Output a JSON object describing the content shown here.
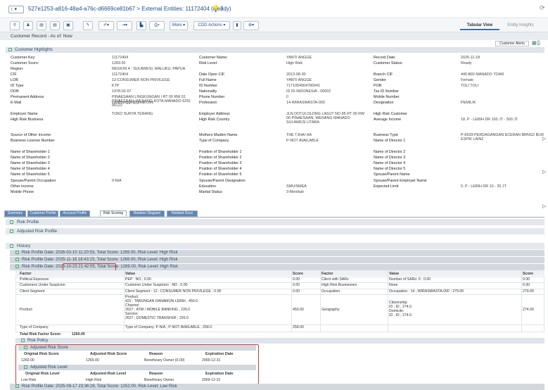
{
  "titlebar": {
    "nav": "↕ ▾",
    "title": "527e1253-a816-48a4-a76c-d6669ce81b67 > External Entities: 11172404 (Ready)",
    "bulb": "💡",
    "help": "?",
    "refresh": "⟳"
  },
  "toolbar": {
    "more_label": "More ▾",
    "cdd_label": "CDD Actions ▾",
    "tab_tabular": "Tabular View",
    "tab_insights": "Entity Insights"
  },
  "record_bar": "Customer Record - As of: Now",
  "alerts_button": "Customer Alerts",
  "highlights_title": "Customer Highlights",
  "fields": [
    {
      "label": "Customer Key:",
      "value": "11172404"
    },
    {
      "label": "Customer Name:",
      "value": "YANTI ANGGE"
    },
    {
      "label": "Record Date:",
      "value": "2025-11-18"
    },
    {
      "label": "Customer Score:",
      "value": "1269.00"
    },
    {
      "label": "Risk Level:",
      "value": "High Risk"
    },
    {
      "label": "Customer Status:",
      "value": "Ready"
    },
    {
      "label": "Region:",
      "value": "REGION 4 : SULAWESI, MALUKU, PAPUA"
    },
    {
      "label": "CIF",
      "value": "11172404"
    },
    {
      "label": "Date Open CIF",
      "value": "2013-08-30"
    },
    {
      "label": "Branch CIF",
      "value": "440-BDI MANADO TOAR"
    },
    {
      "label": "LOB",
      "value": "12-CONSUMER NON PRIVILEGE"
    },
    {
      "label": "Full Name",
      "value": "YANTI ANGGE"
    },
    {
      "label": "Gender",
      "value": "Female"
    },
    {
      "label": "ID Type",
      "value": "KTP"
    },
    {
      "label": "ID Number",
      "value": "7171054904780041"
    },
    {
      "label": "POB",
      "value": "TOLI TOLI"
    },
    {
      "label": "DOB",
      "value": "1978-02-07"
    },
    {
      "label": "Nationality",
      "value": "ID ID-INDONESIA - 00002"
    },
    {
      "label": "Tax ID Number",
      "value": ""
    },
    {
      "label": "Permanent Address",
      "value": "PINAESAAN LINGKUNGAN I RT 00 RW 01 PINAESAAN, WENANG KOTA MANADO 6291 95122"
    },
    {
      "label": "Phone Number",
      "value": "0"
    },
    {
      "label": "Mobile Number",
      "value": ""
    },
    {
      "label": "E-Mail",
      "value": "yantihangge@gmail.com"
    },
    {
      "label": "Profession",
      "value": "14-WIRASWASTA-000"
    },
    {
      "label": "Designation",
      "value": "PEMILIK"
    },
    {
      "label": "Employer Name",
      "value": "TOKO SURYA TERANG"
    },
    {
      "label": "Employer Address",
      "value": "JLN DOTULOLONG LASUT NO 85 RT 00 RW 00 PINAESAAN, WENANG MANADO SULAWESI UTARA"
    },
    {
      "label": "High Risk Customer",
      "value": ""
    },
    {
      "label": "High Risk Business",
      "value": ""
    },
    {
      "label": "High Risk Country",
      "value": ""
    },
    {
      "label": "Average Income",
      "value": "18. P - LEBIH DR 100 JT - 500 JT"
    },
    {
      "label": "Source of Other Income",
      "value": ""
    },
    {
      "label": "Mothers Maiden Name",
      "value": "THE TJHAI HA"
    },
    {
      "label": "Business Type",
      "value": "P-6539-PERDAGANGAN ECERAN BRNG2 BLM ESPIK LAIN2"
    },
    {
      "label": "Business License Number",
      "value": ""
    },
    {
      "label": "Type of Company",
      "value": "P-NOT AVAILABLE"
    },
    {
      "label": "Name of Director 1",
      "value": ""
    },
    {
      "label": "Name of Shareholder 1",
      "value": ""
    },
    {
      "label": "Position of Shareholder 1",
      "value": ""
    },
    {
      "label": "Name of Director 2",
      "value": ""
    },
    {
      "label": "Name of Shareholder 2",
      "value": ""
    },
    {
      "label": "Position of Shareholder 2",
      "value": ""
    },
    {
      "label": "Name of Director 3",
      "value": ""
    },
    {
      "label": "Name of Shareholder 3",
      "value": ""
    },
    {
      "label": "Position of Shareholder 3",
      "value": ""
    },
    {
      "label": "Name of Director 4",
      "value": ""
    },
    {
      "label": "Name of Shareholder 4",
      "value": ""
    },
    {
      "label": "Position of Shareholder 4",
      "value": ""
    },
    {
      "label": "Name of Director 5",
      "value": ""
    },
    {
      "label": "Name of Shareholder 5",
      "value": ""
    },
    {
      "label": "Position of Shareholder 5",
      "value": ""
    },
    {
      "label": "Spouse/Parent Name",
      "value": ""
    },
    {
      "label": "Spouse/Parent Occupation",
      "value": "0-N/A"
    },
    {
      "label": "Spouse/Parent Designation",
      "value": ""
    },
    {
      "label": "Spouse/Parent Employer Name",
      "value": ""
    },
    {
      "label": "Other Income",
      "value": ""
    },
    {
      "label": "Education",
      "value": "SMU/SMEA"
    },
    {
      "label": "Expected Limit",
      "value": "5. P - LEBIH DR 10 - 25 JT"
    },
    {
      "label": "Mobile Phone",
      "value": ""
    },
    {
      "label": "Marital Status",
      "value": "3-Menikah"
    }
  ],
  "tabs": [
    "Summary",
    "Customer Profile",
    "Account Profile",
    "Risk Scoring",
    "Relation Diagram",
    "Related Docs"
  ],
  "sections": {
    "risk_profile": "Risk Profile",
    "adjusted_risk_profile": "Adjusted Risk Profile",
    "history": "History"
  },
  "history_rows": [
    "Risk Profile Date: 2026-02-10 11:20:53, Total Score: 1269.00, Risk Level: High Risk",
    "Risk Profile Date: 2025-11-18 18:43:23, Total Score: 1269.00, Risk Level: High Risk",
    "Risk Profile Date: 2025-10-23 21:42:05, Total Score: 1269.00, Risk Level: High Risk",
    "Risk Profile Date: 2025-08-17 23:36:28, Total Score: 1252.00, Risk Level: Low Risk"
  ],
  "factor_table": {
    "headers": [
      "Factor",
      "Value",
      "Score",
      "Factor",
      "Value",
      "Score"
    ],
    "rows": [
      [
        "Political Exposure",
        "PEP : NO ; 0.00",
        "0.00",
        "Client with SARs",
        "Number of SARs: 0 ; 0.00",
        "0.00"
      ],
      [
        "Customers Under Suspicion",
        "Customer Under Suspicion : NO ; 0.00",
        "0.00",
        "High Risk Businesses",
        "None",
        "0.00"
      ],
      [
        "Client Segment",
        "Client Segment : 12 ; CONSUMER NON PRIVILEGE ; 0.00",
        "0.00",
        "Occupation",
        "Occupation : 14 ; WIRASWASTA-000 ; 279.00",
        "279.00"
      ],
      [
        "Product",
        "Product:\n422 ; TABUNGAN DANAMON LEBIH ; 450.0\nChannel:\n2627 ; ATM / MOBILE BANKING ; 226.0\nService:\n2627 ; DOMESTIC TRANSFER ; 226.0",
        "450.00",
        "Geography",
        "Citizenship:\nID ; ID ; 274.0\nDomicile:\nID ; ID ; 274.0",
        "274.00"
      ],
      [
        "Type of Company",
        "Type of Company: P-N/A ; P-NOT AVAILABLE ; 258.0",
        "258.00",
        "",
        "",
        ""
      ]
    ],
    "total_label": "Total Risk Factor Score:",
    "total_value": "1260.00"
  },
  "risk_policy": "Risk Policy",
  "adjusted_score": {
    "title": "Adjusted Risk Score",
    "headers": [
      "Original Risk Score",
      "Adjusted Risk Score",
      "Reason",
      "Expiration Date"
    ],
    "row": [
      "1260.00",
      "1269.00",
      "Beneficiary Owner (0.00)",
      "2069-12-31"
    ]
  },
  "adjusted_level": {
    "title": "Adjusted Risk Level",
    "headers": [
      "Original Risk Level",
      "Adjusted Risk Level",
      "Reason",
      "Expiration Date"
    ],
    "row": [
      "Low Risk",
      "High Risk",
      "Beneficiary Owner",
      "2069-12-31"
    ]
  }
}
